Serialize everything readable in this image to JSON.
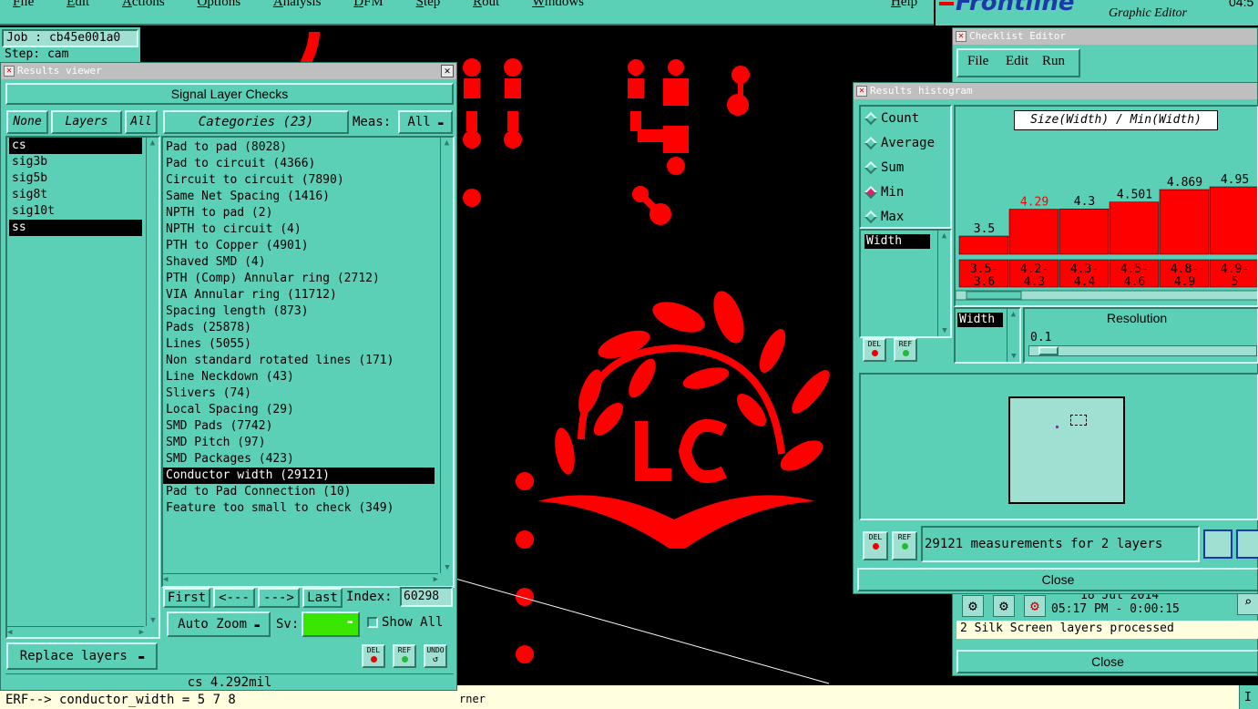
{
  "menubar": {
    "items": [
      "File",
      "Edit",
      "Actions",
      "Options",
      "Analysis",
      "DFM",
      "Step",
      "Rout",
      "Windows"
    ],
    "help": "Help"
  },
  "brand": {
    "logo": "Frontline",
    "app_name": "Graphic Editor",
    "clock": "04:5"
  },
  "job_info": {
    "job": "Job : cb45e001a0",
    "step": "Step: cam"
  },
  "results_viewer": {
    "title": "Results viewer",
    "header": "Signal Layer Checks",
    "layer_buttons": {
      "none": "None",
      "layers": "Layers",
      "all": "All"
    },
    "layers": [
      "cs",
      "sig3b",
      "sig5b",
      "sig8t",
      "sig10t",
      "ss"
    ],
    "selected_layers": [
      "cs",
      "ss"
    ],
    "categories_label": "Categories (23)",
    "meas_label": "Meas:",
    "meas_value": "All",
    "categories": [
      "Pad to pad (8028)",
      "Pad to circuit (4366)",
      "Circuit to circuit (7890)",
      "Same Net Spacing (1416)",
      "NPTH to pad (2)",
      "NPTH to circuit (4)",
      "PTH to Copper (4901)",
      "Shaved SMD (4)",
      "PTH (Comp) Annular ring (2712)",
      "VIA Annular ring (11712)",
      "Spacing length (873)",
      "Pads (25878)",
      "Lines (5055)",
      "Non standard rotated lines (171)",
      "Line Neckdown (43)",
      "Slivers (74)",
      "Local Spacing (29)",
      "SMD Pads (7742)",
      "SMD Pitch (97)",
      "SMD Packages (423)",
      "Conductor width (29121)",
      "Pad to Pad Connection (10)",
      "Feature too small to check (349)"
    ],
    "selected_category": "Conductor width (29121)",
    "nav": {
      "first": "First",
      "prev": "<---",
      "next": "--->",
      "last": "Last",
      "index_label": "Index:",
      "index_value": "60298"
    },
    "auto_zoom": "Auto Zoom",
    "sv_label": "Sv:",
    "show_all": "Show All",
    "replace_layers": "Replace layers",
    "del": "DEL",
    "ref": "REF",
    "undo": "UNDO",
    "status": "cs 4.292mil"
  },
  "command_line": "ERF--> conductor_width = 5 7 8",
  "bottom_status": "rner",
  "bottom_right_status": "I",
  "checklist_editor": {
    "title": "Checklist Editor",
    "menu": [
      "File",
      "Edit",
      "Run"
    ],
    "date": "18 Jul 2014",
    "time": "05:17 PM - 0:00:15",
    "message": "2 Silk Screen layers processed",
    "close": "Close"
  },
  "results_histogram": {
    "title": "Results histogram",
    "modes": [
      "Count",
      "Average",
      "Sum",
      "Min",
      "Max"
    ],
    "selected_mode": "Min",
    "field_value": "Width",
    "chart_title": "Size(Width) / Min(Width)",
    "resolution_label": "Resolution",
    "resolution_value": "0.1",
    "field_list": [
      "Width"
    ],
    "del": "DEL",
    "ref": "REF",
    "status": "29121 measurements for 2 layers",
    "close": "Close"
  },
  "chart_data": {
    "type": "bar",
    "title": "Size(Width) / Min(Width)",
    "categories": [
      "3.5-\n3.6",
      "4.2-\n4.3",
      "4.3-\n4.4",
      "4.5-\n4.6",
      "4.8-\n4.9",
      "4.9-\n5"
    ],
    "values": [
      3.5,
      4.29,
      4.3,
      4.501,
      4.869,
      4.95
    ],
    "value_labels": [
      "3.5",
      "4.29",
      "4.3",
      "4.501",
      "4.869",
      "4.95"
    ],
    "highlight_index": 1,
    "bar_color": "#ff0000",
    "highlight_label_color": "#ff0000"
  },
  "colors": {
    "panel": "#5ccfb7",
    "canvas": "#000000",
    "copper": "#ff0000",
    "selected": "#000000"
  }
}
